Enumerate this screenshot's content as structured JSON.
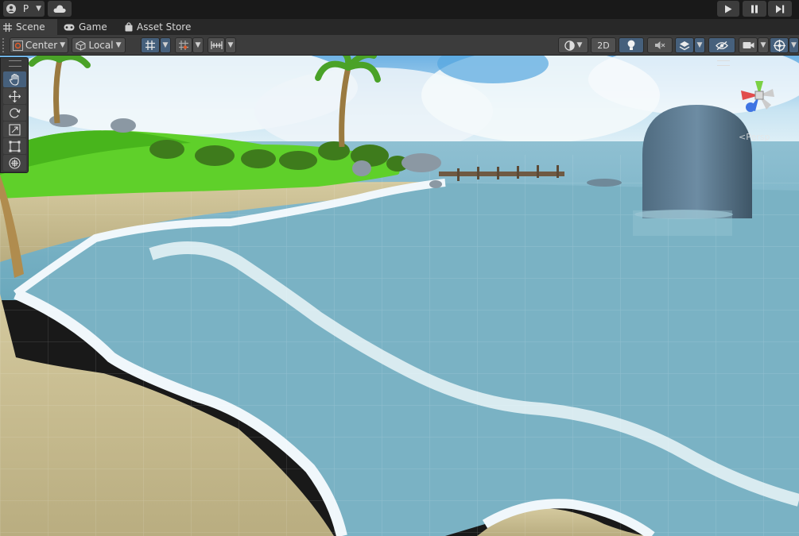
{
  "topbar": {
    "account_label": "P",
    "account_icon": "account-icon",
    "cloud_icon": "cloud-icon",
    "play_icon": "play-icon",
    "pause_icon": "pause-icon",
    "step_icon": "step-icon"
  },
  "tabs": [
    {
      "label": "Scene",
      "icon": "grid-icon",
      "active": true
    },
    {
      "label": "Game",
      "icon": "gamepad-icon",
      "active": false
    },
    {
      "label": "Asset Store",
      "icon": "bag-icon",
      "active": false
    }
  ],
  "toolbar": {
    "pivot_mode": "Center",
    "pivot_rotation": "Local",
    "render_2d": "2D"
  },
  "viewport": {
    "projection_label": "Persp",
    "sky_color": "#8ec3e6",
    "sea_color": "#79aebf",
    "sand_color": "#c3b88c",
    "foam_color": "#eef6fb",
    "grass_color": "#5fd02a"
  },
  "tools": [
    {
      "name": "hand-tool",
      "icon": "hand-icon",
      "active": true
    },
    {
      "name": "move-tool",
      "icon": "move-icon",
      "active": false
    },
    {
      "name": "rotate-tool",
      "icon": "rotate-icon",
      "active": false
    },
    {
      "name": "scale-tool",
      "icon": "scale-icon",
      "active": false
    },
    {
      "name": "rect-tool",
      "icon": "rect-icon",
      "active": false
    },
    {
      "name": "transform-tool",
      "icon": "transform-icon",
      "active": false
    }
  ]
}
